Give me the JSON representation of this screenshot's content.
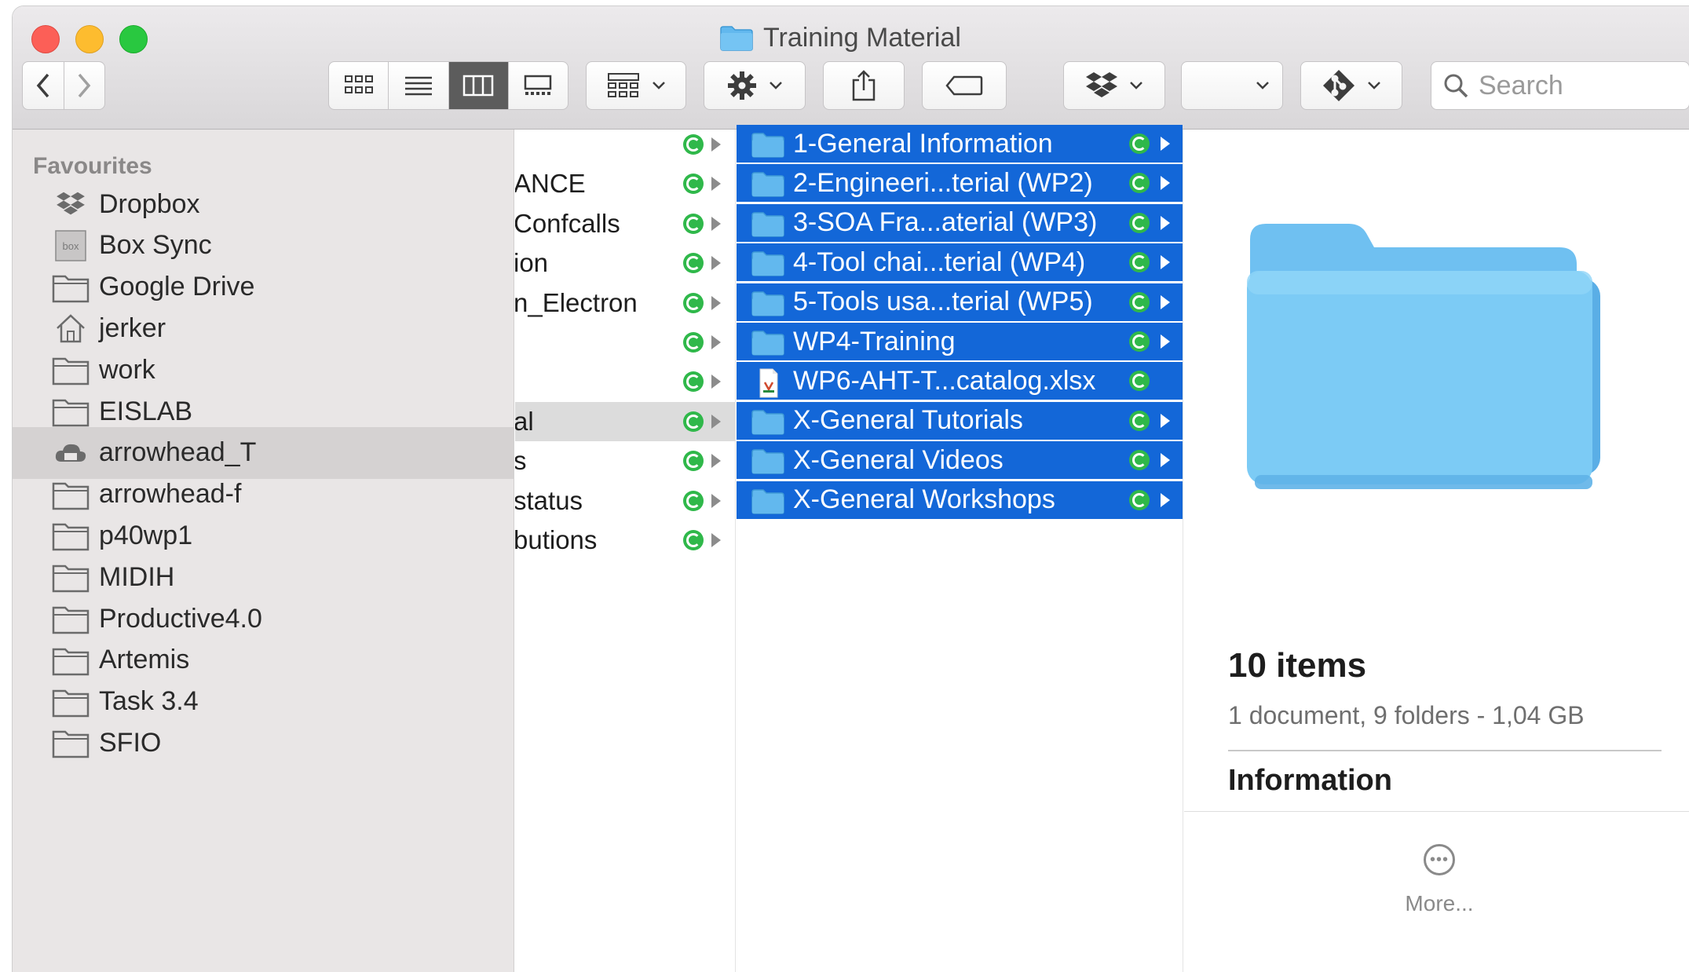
{
  "window": {
    "title": "Training Material"
  },
  "toolbar": {
    "back_icon": "chevron-left-icon",
    "forward_icon": "chevron-right-icon",
    "view_modes": [
      "icon-view",
      "list-view",
      "column-view",
      "gallery-view"
    ],
    "active_view": "column-view",
    "search_placeholder": "Search"
  },
  "sidebar": {
    "heading": "Favourites",
    "items": [
      {
        "label": "Dropbox",
        "icon": "dropbox-icon"
      },
      {
        "label": "Box Sync",
        "icon": "box-icon"
      },
      {
        "label": "Google Drive",
        "icon": "folder-icon"
      },
      {
        "label": "jerker",
        "icon": "home-icon"
      },
      {
        "label": "work",
        "icon": "folder-icon"
      },
      {
        "label": "EISLAB",
        "icon": "folder-icon"
      },
      {
        "label": "arrowhead_T",
        "icon": "cloud-folder-icon",
        "selected": true
      },
      {
        "label": "arrowhead-f",
        "icon": "folder-icon"
      },
      {
        "label": "p40wp1",
        "icon": "folder-icon"
      },
      {
        "label": "MIDIH",
        "icon": "folder-icon"
      },
      {
        "label": "Productive4.0",
        "icon": "folder-icon"
      },
      {
        "label": "Artemis",
        "icon": "folder-icon"
      },
      {
        "label": "Task 3.4",
        "icon": "folder-icon"
      },
      {
        "label": "SFIO",
        "icon": "folder-icon"
      }
    ]
  },
  "column1": {
    "rows": [
      {
        "label": ""
      },
      {
        "label": "ANCE"
      },
      {
        "label": "Confcalls"
      },
      {
        "label": "ion"
      },
      {
        "label": "n_Electron"
      },
      {
        "label": ""
      },
      {
        "label": ""
      },
      {
        "label": "al",
        "selected": true
      },
      {
        "label": "s"
      },
      {
        "label": "status"
      },
      {
        "label": "butions"
      }
    ]
  },
  "column2": {
    "rows": [
      {
        "label": "1-General Information",
        "type": "folder"
      },
      {
        "label": "2-Engineeri...terial (WP2)",
        "type": "folder"
      },
      {
        "label": "3-SOA Fra...aterial (WP3)",
        "type": "folder"
      },
      {
        "label": "4-Tool chai...terial (WP4)",
        "type": "folder"
      },
      {
        "label": "5-Tools usa...terial (WP5)",
        "type": "folder"
      },
      {
        "label": "WP4-Training",
        "type": "folder"
      },
      {
        "label": "WP6-AHT-T...catalog.xlsx",
        "type": "document"
      },
      {
        "label": "X-General Tutorials",
        "type": "folder"
      },
      {
        "label": "X-General Videos",
        "type": "folder"
      },
      {
        "label": "X-General Workshops",
        "type": "folder"
      }
    ]
  },
  "preview": {
    "title": "10 items",
    "subtitle": "1 document, 9 folders - 1,04 GB",
    "info_heading": "Information",
    "more_label": "More..."
  },
  "colors": {
    "selection": "#1367d8",
    "folder": "#62b8ee",
    "sync": "#2fb84a"
  }
}
